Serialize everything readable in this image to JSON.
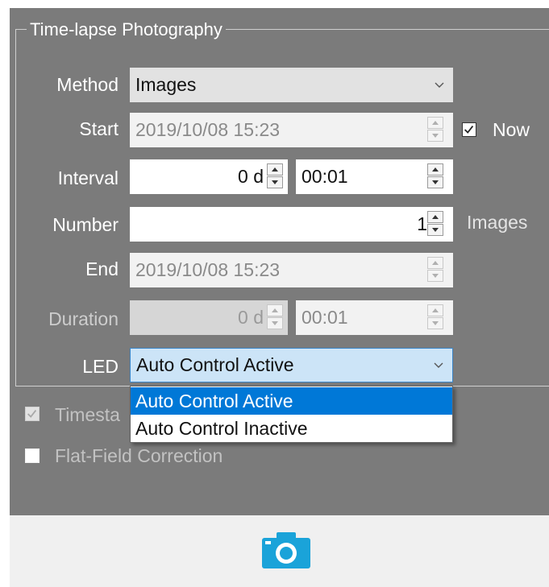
{
  "group_title": "Time-lapse Photography",
  "method": {
    "label": "Method",
    "value": "Images"
  },
  "start": {
    "label": "Start",
    "value": "2019/10/08 15:23",
    "now_label": "Now",
    "now_checked": true
  },
  "interval": {
    "label": "Interval",
    "days": "0 d",
    "time": "00:01"
  },
  "number": {
    "label": "Number",
    "value": "1",
    "unit": "Images"
  },
  "end": {
    "label": "End",
    "value": "2019/10/08 15:23"
  },
  "duration": {
    "label": "Duration",
    "days": "0 d",
    "time": "00:01"
  },
  "led": {
    "label": "LED",
    "value": "Auto Control Active",
    "options": [
      "Auto Control Active",
      "Auto Control Inactive"
    ],
    "highlighted_option": "Auto Control Active"
  },
  "timestamp": {
    "label_visible": "Timesta",
    "checked": true
  },
  "flat_field": {
    "label": "Flat-Field Correction",
    "checked": false
  },
  "capture_button": {
    "icon": "camera-icon"
  },
  "colors": {
    "panel_bg": "#7b7b7b",
    "accent": "#0078d7",
    "camera_icon": "#1aa3d9",
    "combo_focus_bg": "#cce4f7"
  }
}
